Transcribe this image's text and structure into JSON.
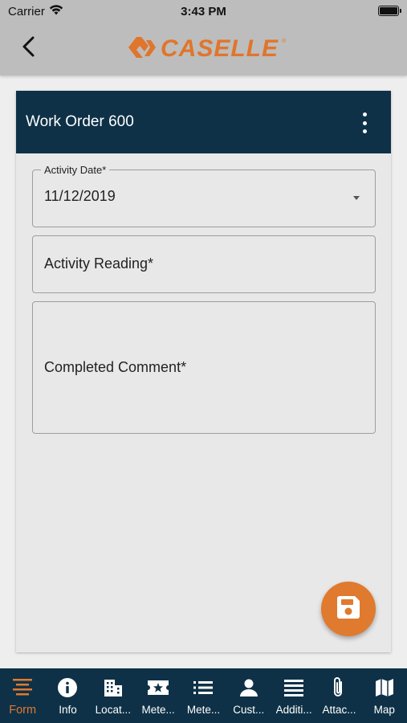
{
  "status_bar": {
    "carrier": "Carrier",
    "time": "3:43 PM"
  },
  "header": {
    "logo_text": "CASELLE",
    "logo_reg": "®",
    "back_icon": "chevron-left-icon"
  },
  "card": {
    "title": "Work Order 600",
    "menu_icon": "more-vertical-icon"
  },
  "form": {
    "activity_date_label": "Activity Date*",
    "activity_date_value": "11/12/2019",
    "activity_reading_placeholder": "Activity Reading*",
    "completed_comment_placeholder": "Completed Comment*"
  },
  "fab": {
    "icon": "save-icon"
  },
  "tabs": [
    {
      "label": "Form",
      "icon": "form-lines-icon",
      "active": true
    },
    {
      "label": "Info",
      "icon": "info-icon"
    },
    {
      "label": "Locat...",
      "icon": "building-icon"
    },
    {
      "label": "Mete...",
      "icon": "ticket-star-icon"
    },
    {
      "label": "Mete...",
      "icon": "list-icon"
    },
    {
      "label": "Cust...",
      "icon": "person-icon"
    },
    {
      "label": "Additi...",
      "icon": "menu-lines-icon"
    },
    {
      "label": "Attac...",
      "icon": "paperclip-icon"
    },
    {
      "label": "Map",
      "icon": "map-icon"
    }
  ],
  "colors": {
    "brand_orange": "#e07a2f",
    "navy": "#0e3147",
    "header_gray": "#bdbdbd"
  }
}
